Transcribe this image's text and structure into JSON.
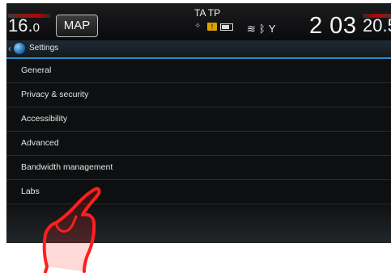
{
  "statusbar": {
    "temp_left_big": "16.",
    "temp_left_small": "0",
    "map_label": "MAP",
    "ta_tp": "TA TP",
    "clock": "2 03",
    "temp_right": "20.5"
  },
  "titlebar": {
    "title": "Settings"
  },
  "settings_list": [
    {
      "label": "General"
    },
    {
      "label": "Privacy & security"
    },
    {
      "label": "Accessibility"
    },
    {
      "label": "Advanced"
    },
    {
      "label": "Bandwidth management"
    },
    {
      "label": "Labs"
    }
  ],
  "colors": {
    "accent": "#2a8fbf",
    "hand": "#ff2020",
    "warning": "#e0a000"
  }
}
